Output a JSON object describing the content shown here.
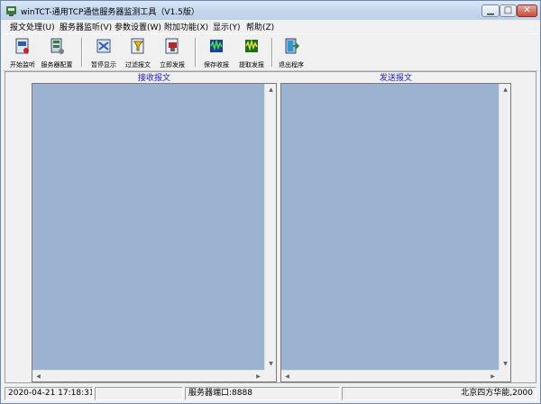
{
  "window": {
    "title": "winTCT-通用TCP通信服务器监测工具（V1.5版）"
  },
  "menu": [
    {
      "label": "报文处理(U)"
    },
    {
      "label": "服务器监听(V)"
    },
    {
      "label": "参数设置(W)"
    },
    {
      "label": "附加功能(X)"
    },
    {
      "label": "显示(Y)"
    },
    {
      "label": "帮助(Z)"
    }
  ],
  "toolbar": [
    {
      "label": "开始监听",
      "icon": "start-listen-icon"
    },
    {
      "label": "服务器配置",
      "icon": "server-config-icon"
    },
    {
      "label": "暂停显示",
      "icon": "pause-display-icon"
    },
    {
      "label": "过滤报文",
      "icon": "filter-icon"
    },
    {
      "label": "立即发报",
      "icon": "send-now-icon"
    },
    {
      "label": "保存收报",
      "icon": "save-received-icon"
    },
    {
      "label": "提取发报",
      "icon": "extract-send-icon"
    },
    {
      "label": "退出程序",
      "icon": "exit-icon"
    }
  ],
  "panes": {
    "received_title": "接收报文",
    "sent_title": "发送报文"
  },
  "status": {
    "datetime": "2020-04-21 17:18:31",
    "port": "服务器端口:8888",
    "copyright": "北京四方华能,2000"
  },
  "colors": {
    "pane_bg": "#9bb3d1",
    "pane_title": "#1818d0"
  }
}
